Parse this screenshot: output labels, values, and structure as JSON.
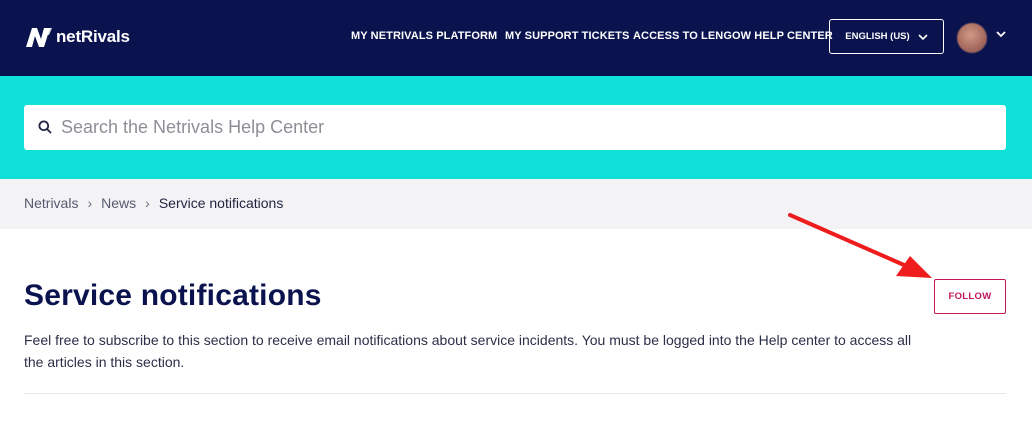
{
  "header": {
    "logo_text": "netRivals",
    "nav": [
      {
        "label": "MY NETRIVALS PLATFORM"
      },
      {
        "label": "MY SUPPORT TICKETS"
      },
      {
        "label": "ACCESS TO LENGOW HELP CENTER"
      }
    ],
    "language_label": "ENGLISH (US)"
  },
  "search": {
    "placeholder": "Search the Netrivals Help Center"
  },
  "breadcrumb": {
    "items": [
      "Netrivals",
      "News",
      "Service notifications"
    ],
    "separator": "›"
  },
  "section": {
    "title": "Service notifications",
    "description": "Feel free to subscribe to this section to receive email notifications about service incidents. You must be logged into the Help center to access all the articles in this section.",
    "follow_label": "FOLLOW"
  },
  "colors": {
    "header_bg": "#0b134f",
    "hero_bg": "#0fe0d8",
    "accent": "#c2185b",
    "annotation_arrow": "#ee1c1c"
  }
}
